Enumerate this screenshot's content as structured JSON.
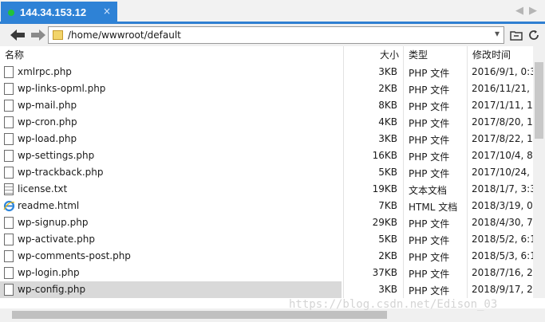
{
  "tab": {
    "title": "144.34.153.12",
    "close": "×"
  },
  "nav": {
    "prev_tab": "◀",
    "next_tab": "▶",
    "back": "🡐",
    "forward": "🡒"
  },
  "address": {
    "path": "/home/wwwroot/default",
    "dropdown": "▾"
  },
  "columns": {
    "name": "名称",
    "size": "大小",
    "type": "类型",
    "modified": "修改时间"
  },
  "files": [
    {
      "name": "xmlrpc.php",
      "size": "3KB",
      "type": "PHP 文件",
      "modified": "2016/9/1, 0:3"
    },
    {
      "name": "wp-links-opml.php",
      "size": "2KB",
      "type": "PHP 文件",
      "modified": "2016/11/21,"
    },
    {
      "name": "wp-mail.php",
      "size": "8KB",
      "type": "PHP 文件",
      "modified": "2017/1/11, 1"
    },
    {
      "name": "wp-cron.php",
      "size": "4KB",
      "type": "PHP 文件",
      "modified": "2017/8/20, 1"
    },
    {
      "name": "wp-load.php",
      "size": "3KB",
      "type": "PHP 文件",
      "modified": "2017/8/22, 1"
    },
    {
      "name": "wp-settings.php",
      "size": "16KB",
      "type": "PHP 文件",
      "modified": "2017/10/4, 8"
    },
    {
      "name": "wp-trackback.php",
      "size": "5KB",
      "type": "PHP 文件",
      "modified": "2017/10/24,"
    },
    {
      "name": "license.txt",
      "size": "19KB",
      "type": "文本文档",
      "modified": "2018/1/7, 3:3"
    },
    {
      "name": "readme.html",
      "size": "7KB",
      "type": "HTML 文档",
      "modified": "2018/3/19, 0"
    },
    {
      "name": "wp-signup.php",
      "size": "29KB",
      "type": "PHP 文件",
      "modified": "2018/4/30, 7"
    },
    {
      "name": "wp-activate.php",
      "size": "5KB",
      "type": "PHP 文件",
      "modified": "2018/5/2, 6:1"
    },
    {
      "name": "wp-comments-post.php",
      "size": "2KB",
      "type": "PHP 文件",
      "modified": "2018/5/3, 6:1"
    },
    {
      "name": "wp-login.php",
      "size": "37KB",
      "type": "PHP 文件",
      "modified": "2018/7/16, 2"
    },
    {
      "name": "wp-config.php",
      "size": "3KB",
      "type": "PHP 文件",
      "modified": "2018/9/17, 2"
    }
  ],
  "watermark": "https://blog.csdn.net/Edison_03",
  "colors": {
    "tab_active": "#2e82d6",
    "tab_dot": "#22c23a",
    "selected_row": "#d9d9d9"
  },
  "icons": {
    "file": "document-icon",
    "text": "text-document-icon",
    "html": "ie-html-icon",
    "folder": "folder-icon"
  }
}
